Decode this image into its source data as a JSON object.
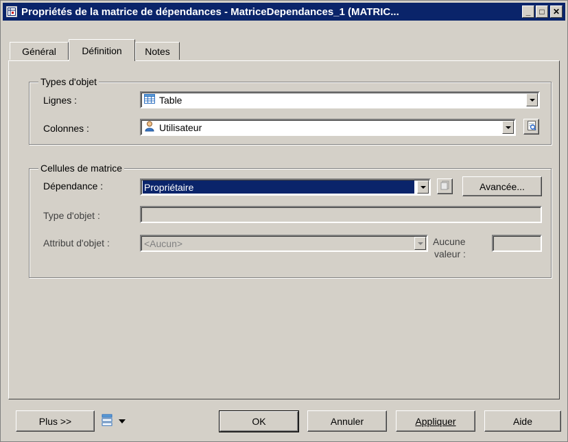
{
  "window": {
    "title": "Propriétés de la matrice de dépendances - MatriceDependances_1 (MATRIC...",
    "title_icon": "matrix-icon",
    "controls": {
      "minimize": "_",
      "maximize": "□",
      "close": "✕"
    }
  },
  "tabs": [
    {
      "label": "Général",
      "active": false
    },
    {
      "label": "Définition",
      "active": true
    },
    {
      "label": "Notes",
      "active": false
    }
  ],
  "object_types": {
    "legend": "Types d'objet",
    "rows_label": "Lignes :",
    "rows_value": "Table",
    "rows_icon": "table-icon",
    "columns_label": "Colonnes :",
    "columns_value": "Utilisateur",
    "columns_icon": "user-icon",
    "properties_icon": "properties-icon"
  },
  "matrix_cells": {
    "legend": "Cellules de matrice",
    "dependency_label": "Dépendance :",
    "dependency_value": "Propriétaire",
    "create_icon": "create-dependency-icon",
    "advanced_label": "Avancée...",
    "object_type_label": "Type d'objet :",
    "object_type_value": "",
    "object_attribute_label": "Attribut d'objet :",
    "object_attribute_value": "<Aucun>",
    "no_value_label_1": "Aucune",
    "no_value_label_2": "valeur :",
    "no_value_value": ""
  },
  "footer": {
    "more_label": "Plus >>",
    "menu_icon": "list-menu-icon",
    "ok_label": "OK",
    "cancel_label": "Annuler",
    "apply_label": "Appliquer",
    "help_label": "Aide"
  },
  "colors": {
    "titlebar": "#0a246a",
    "face": "#d4d0c8",
    "selection": "#0a246a"
  }
}
